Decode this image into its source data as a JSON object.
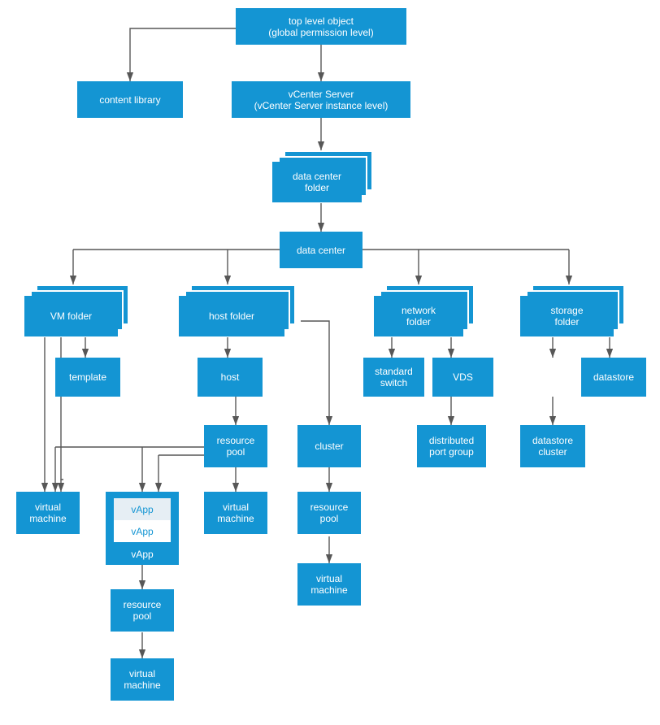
{
  "colors": {
    "node": "#1495d3",
    "text": "#ffffff",
    "arrow": "#575757",
    "vapp_inner_top": "#e6eef4"
  },
  "nodes": {
    "top_level_object": {
      "line1": "top level object",
      "line2": "(global permission level)"
    },
    "content_library": {
      "line1": "content library"
    },
    "vcenter_server": {
      "line1": "vCenter Server",
      "line2": "(vCenter Server instance level)"
    },
    "data_center_folder": {
      "line1": "data center",
      "line2": "folder"
    },
    "data_center": {
      "line1": "data center"
    },
    "vm_folder": {
      "line1": "VM folder"
    },
    "host_folder": {
      "line1": "host folder"
    },
    "network_folder": {
      "line1": "network",
      "line2": "folder"
    },
    "storage_folder": {
      "line1": "storage",
      "line2": "folder"
    },
    "template": {
      "line1": "template"
    },
    "host": {
      "line1": "host"
    },
    "standard_switch": {
      "line1": "standard",
      "line2": "switch"
    },
    "vds": {
      "line1": "VDS"
    },
    "datastore": {
      "line1": "datastore"
    },
    "resource_pool_host": {
      "line1": "resource",
      "line2": "pool"
    },
    "cluster": {
      "line1": "cluster"
    },
    "distributed_port_group": {
      "line1": "distributed",
      "line2": "port group"
    },
    "datastore_cluster": {
      "line1": "datastore",
      "line2": "cluster"
    },
    "virtual_machine_left": {
      "line1": "virtual",
      "line2": "machine"
    },
    "virtual_machine_host_rp": {
      "line1": "virtual",
      "line2": "machine"
    },
    "resource_pool_cluster": {
      "line1": "resource",
      "line2": "pool"
    },
    "virtual_machine_cluster": {
      "line1": "virtual",
      "line2": "machine"
    },
    "vapp": {
      "inner_top": "vApp",
      "inner_bottom": "vApp",
      "outer": "vApp"
    },
    "resource_pool_vapp": {
      "line1": "resource",
      "line2": "pool"
    },
    "virtual_machine_vapp": {
      "line1": "virtual",
      "line2": "machine"
    }
  }
}
